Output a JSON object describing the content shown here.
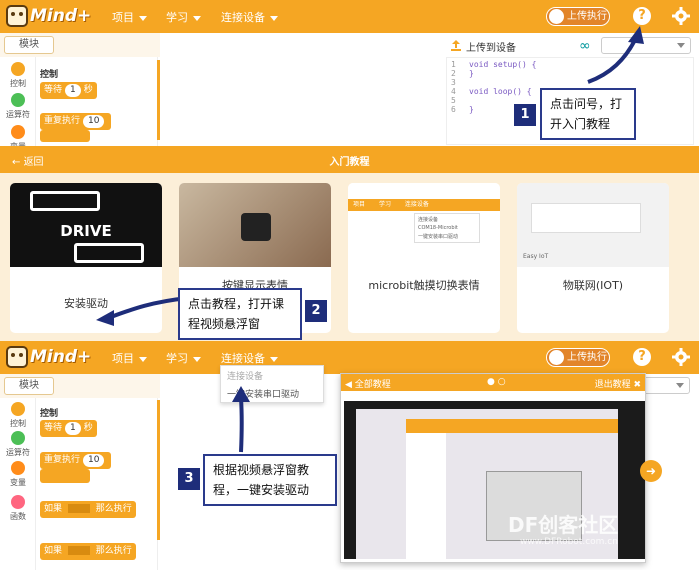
{
  "app": {
    "logo_text": "Mind+"
  },
  "menu": {
    "project": "项目",
    "learn": "学习",
    "connect": "连接设备"
  },
  "toolbar": {
    "upload_mode": "上传执行"
  },
  "palette": {
    "tab": "模块",
    "categories": [
      "控制",
      "运算符",
      "变量",
      "函数"
    ],
    "title": "控制",
    "wait": "等待",
    "wait_num": "1",
    "wait_unit": "秒",
    "repeat": "重复执行",
    "repeat_num": "10",
    "if_label": "如果",
    "then_label": "那么执行"
  },
  "code_panel": {
    "upload_to_device": "上传到设备",
    "lines": [
      "1",
      "2",
      "3",
      "4",
      "5",
      "6"
    ],
    "code": [
      "void setup() {",
      "}",
      "",
      "void loop() {",
      "",
      "}"
    ]
  },
  "callouts": [
    {
      "num": "1",
      "text_line1": "点击问号，打",
      "text_line2": "开入门教程"
    },
    {
      "num": "2",
      "text_line1": "点击教程，打开课",
      "text_line2": "程视频悬浮窗"
    },
    {
      "num": "3",
      "text_line1": "根据视频悬浮窗教",
      "text_line2": "程，一键安装驱动"
    }
  ],
  "intro": {
    "back": "返回",
    "title": "入门教程",
    "cards": [
      {
        "label": "安装驱动",
        "drive_text": "DRIVE"
      },
      {
        "label": "按键显示表情"
      },
      {
        "label": "microbit触摸切换表情",
        "mini_menu": [
          "项目",
          "学习",
          "连接设备"
        ],
        "mini_dropdown": [
          "连接设备",
          "COM18-Microbit",
          "一键安装串口驱动"
        ]
      },
      {
        "label": "物联网(IOT)",
        "mini_text": "Easy IoT"
      }
    ]
  },
  "dropdown": {
    "item1": "连接设备",
    "item2": "一键安装串口驱动"
  },
  "video_panel": {
    "title": "全部教程",
    "exit": "退出教程 ✖"
  },
  "watermark": {
    "brand": "DF创客社区",
    "url": "www.DFRobot.com.cn"
  },
  "colors": {
    "accent": "#f5a623",
    "callout_border": "#2a3a8c",
    "badge": "#1e2d7a"
  }
}
